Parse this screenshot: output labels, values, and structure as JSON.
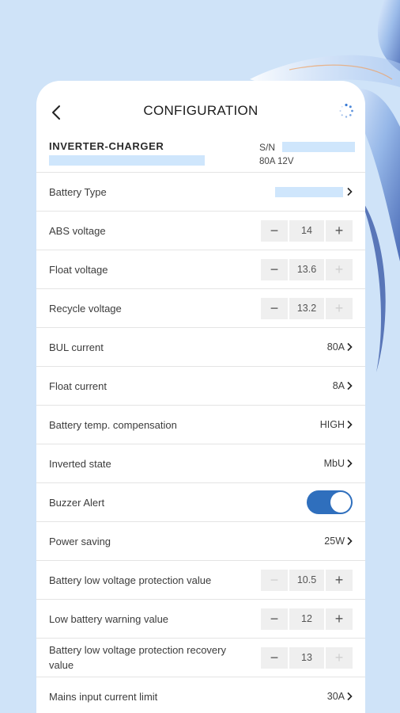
{
  "header": {
    "title": "CONFIGURATION"
  },
  "device": {
    "name": "INVERTER-CHARGER",
    "sn_label": "S/N",
    "spec": "80A 12V"
  },
  "settings": {
    "battery_type": {
      "label": "Battery Type"
    },
    "abs_voltage": {
      "label": "ABS voltage",
      "value": "14"
    },
    "float_voltage": {
      "label": "Float voltage",
      "value": "13.6"
    },
    "recycle_voltage": {
      "label": "Recycle voltage",
      "value": "13.2"
    },
    "bul_current": {
      "label": "BUL current",
      "value": "80A"
    },
    "float_current": {
      "label": "Float current",
      "value": "8A"
    },
    "temp_compensation": {
      "label": "Battery temp. compensation",
      "value": "HIGH"
    },
    "inverted_state": {
      "label": "Inverted state",
      "value": "MbU"
    },
    "buzzer_alert": {
      "label": "Buzzer Alert",
      "enabled": true
    },
    "power_saving": {
      "label": "Power saving",
      "value": "25W"
    },
    "low_voltage_protection": {
      "label": "Battery low voltage protection value",
      "value": "10.5"
    },
    "low_battery_warning": {
      "label": "Low battery warning value",
      "value": "12"
    },
    "low_voltage_recovery": {
      "label": "Battery low voltage protection recovery value",
      "value": "13"
    },
    "mains_current_limit": {
      "label": "Mains input current limit",
      "value": "30A"
    }
  },
  "stepper": {
    "minus": "−",
    "plus": "+"
  },
  "colors": {
    "accent": "#2f6fbd",
    "background": "#cfe3f8",
    "placeholder": "#cfe6fc"
  },
  "icons": [
    "back-arrow-icon",
    "loading-spinner-icon",
    "chevron-right-icon",
    "minus-icon",
    "plus-icon"
  ]
}
